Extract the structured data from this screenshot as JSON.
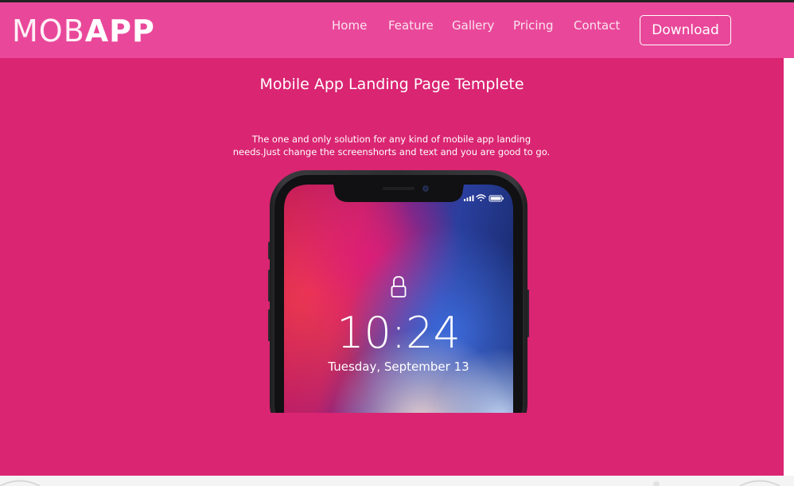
{
  "brand": {
    "logo_light": "MOB",
    "logo_bold": "APP"
  },
  "nav": {
    "items": [
      {
        "label": "Home"
      },
      {
        "label": "Feature"
      },
      {
        "label": "Gallery"
      },
      {
        "label": "Pricing"
      },
      {
        "label": "Contact"
      }
    ],
    "download_label": "Download"
  },
  "hero": {
    "title": "Mobile App Landing Page Templete",
    "subtitle": "The one and only solution for any kind of mobile app landing needs.Just change the screenshorts and text and you are good to go.",
    "phone": {
      "time": "10:24",
      "date": "Tuesday, September 13"
    }
  },
  "icons": {
    "lock": "lock-icon",
    "signal": "signal-icon",
    "wifi": "wifi-icon",
    "battery": "battery-icon",
    "camera": "front-camera-icon",
    "speaker": "speaker-icon"
  },
  "colors": {
    "navbar": "#e9489a",
    "hero_bg": "#da2572",
    "phone_frame": "#2b2b2e",
    "text": "#ffffff"
  }
}
